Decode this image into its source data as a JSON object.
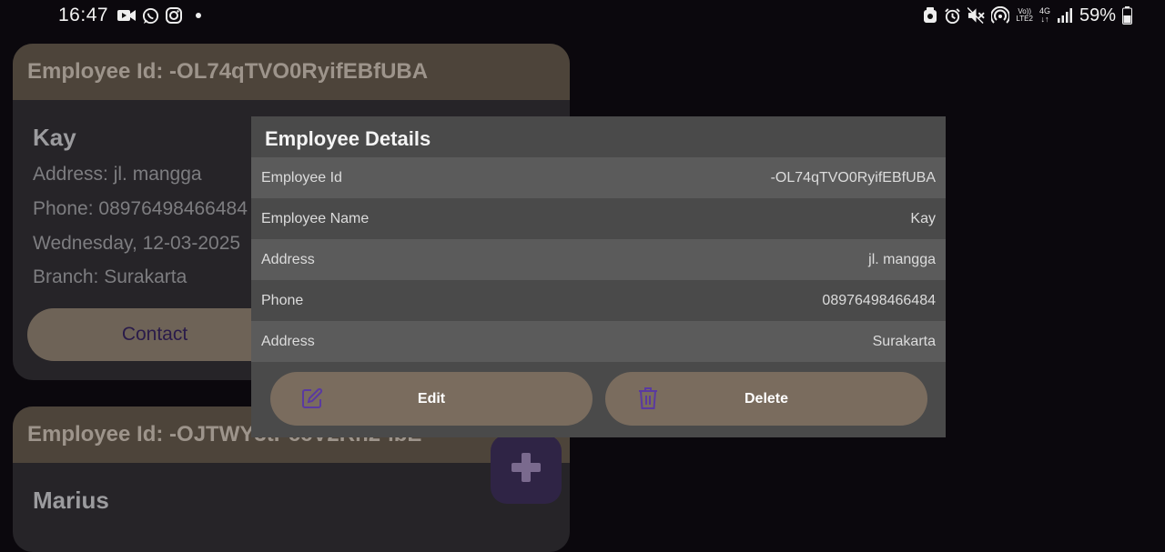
{
  "status_bar": {
    "time": "16:47",
    "battery": "59%",
    "volte_label": "Vo)) LTE2",
    "network": "4G",
    "icons_left": [
      "video-icon",
      "whatsapp-icon",
      "instagram-icon",
      "dot-icon"
    ],
    "icons_right": [
      "alarm-lock-icon",
      "alarm-icon",
      "mute-icon",
      "hotspot-icon",
      "volte-icon",
      "network-4g-icon",
      "signal-icon",
      "battery-icon"
    ]
  },
  "cards": [
    {
      "header": "Employee Id:  -OL74qTVO0RyifEBfUBA",
      "name": "Kay",
      "address": "Address: jl. mangga",
      "phone": "Phone: 08976498466484",
      "date": "Wednesday, 12-03-2025",
      "branch": "Branch: Surakarta",
      "contact_label": "Contact"
    },
    {
      "header": "Employee Id:  -OJTWY3tPccV2Rh2-lbE",
      "name": "Marius"
    }
  ],
  "dialog": {
    "title": "Employee Details",
    "rows": [
      {
        "label": "Employee Id",
        "value": "-OL74qTVO0RyifEBfUBA"
      },
      {
        "label": "Employee Name",
        "value": "Kay"
      },
      {
        "label": "Address",
        "value": "jl. mangga"
      },
      {
        "label": "Phone",
        "value": "08976498466484"
      },
      {
        "label": "Address",
        "value": "Surakarta"
      }
    ],
    "edit_label": "Edit",
    "delete_label": "Delete"
  },
  "colors": {
    "background": "#0b080d",
    "card": "#262428",
    "card_header": "#4d443a",
    "dialog": "#4a4a4a",
    "button": "#7a6c5e",
    "accent_purple": "#5a3aa0"
  }
}
